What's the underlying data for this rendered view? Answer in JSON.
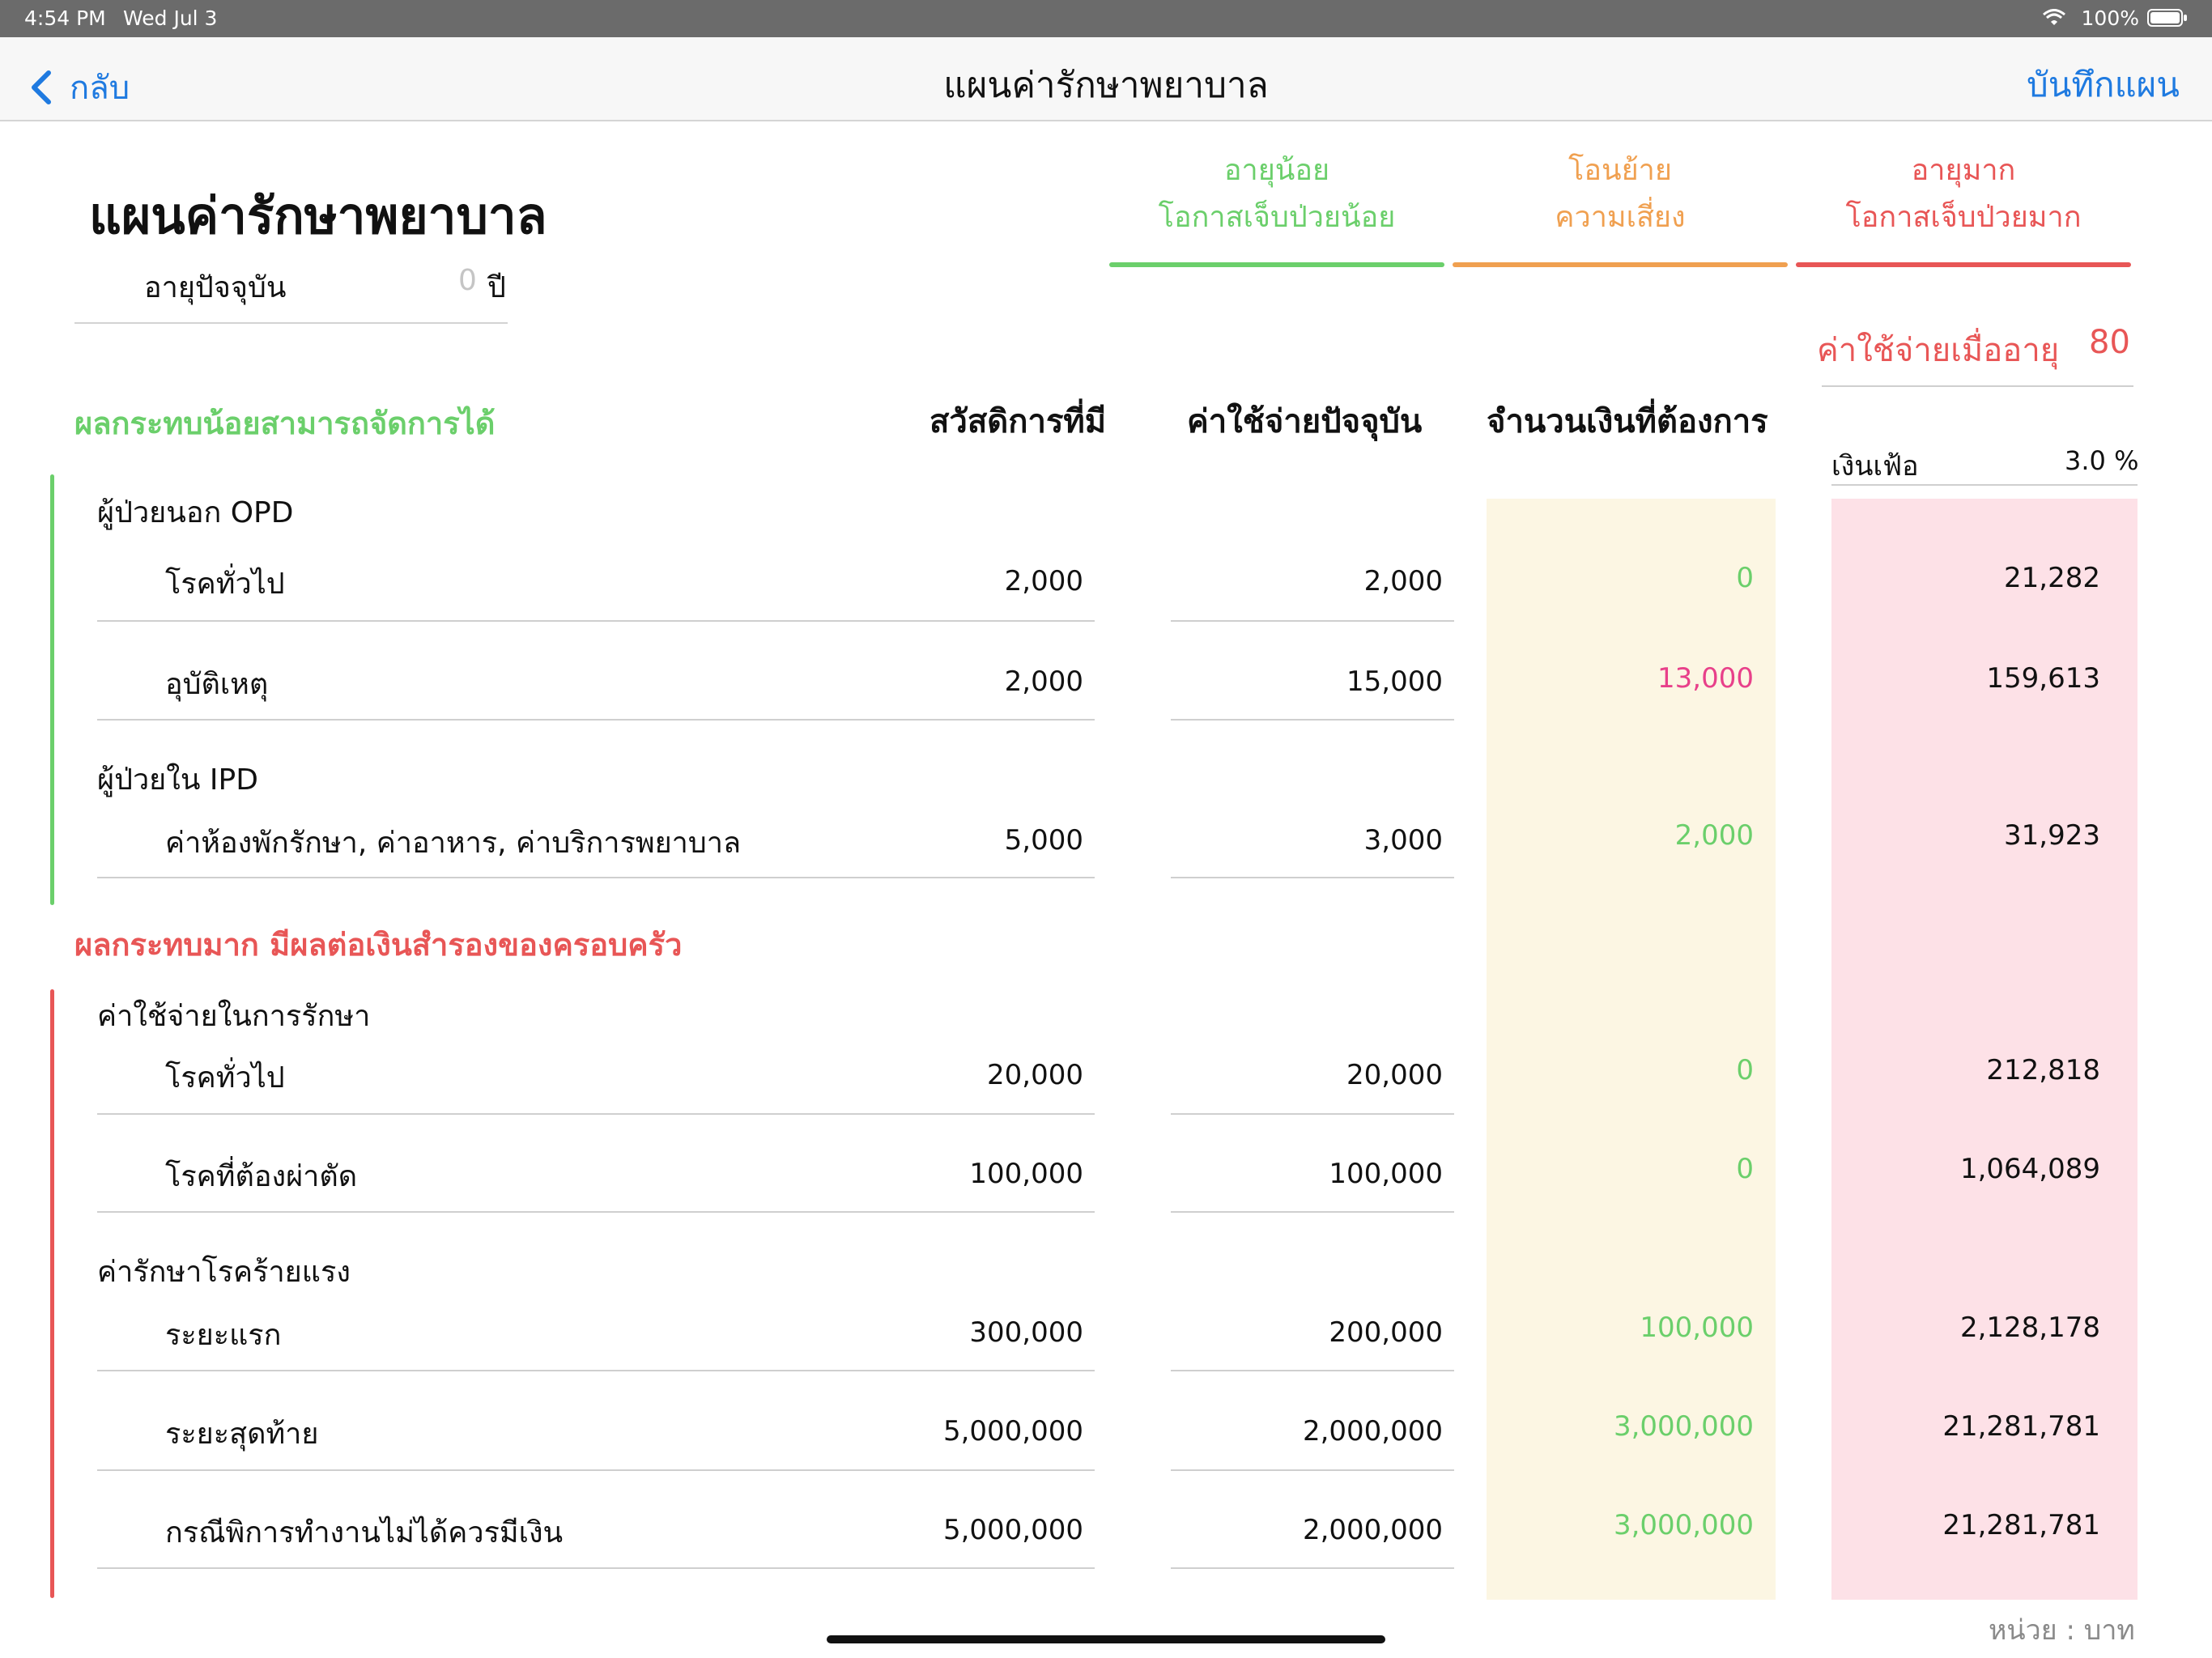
{
  "status_bar": {
    "time": "4:54 PM",
    "date": "Wed Jul 3",
    "battery": "100%"
  },
  "nav": {
    "back_label": "กลับ",
    "title": "แผนค่ารักษาพยาบาล",
    "save_label": "บันทึกแผน"
  },
  "page_title": "แผนค่ารักษาพยาบาล",
  "age": {
    "label": "อายุปัจจุบัน",
    "value": "0",
    "unit": "ปี"
  },
  "tabs": [
    {
      "line1": "อายุน้อย",
      "line2": "โอกาสเจ็บป่วยน้อย",
      "color": "#6bcf6b"
    },
    {
      "line1": "โอนย้าย",
      "line2": "ความเสี่ยง",
      "color": "#f0a050"
    },
    {
      "line1": "อายุมาก",
      "line2": "โอกาสเจ็บป่วยมาก",
      "color": "#e85656"
    }
  ],
  "future_age": {
    "label": "ค่าใช้จ่ายเมื่ออายุ",
    "value": "80"
  },
  "inflation": {
    "label": "เงินเฟ้อ",
    "value": "3.0 %"
  },
  "columns": {
    "benefits": "สวัสดิการที่มี",
    "current_cost": "ค่าใช้จ่ายปัจจุบัน",
    "needed": "จำนวนเงินที่ต้องการ"
  },
  "section_low": {
    "title": "ผลกระทบน้อยสามารถจัดการได้",
    "groups": [
      {
        "name": "ผู้ป่วยนอก OPD",
        "rows": [
          {
            "name": "โรคทั่วไป",
            "benefit": "2,000",
            "current": "2,000",
            "needed": "0",
            "needed_color": "#6bcf6b",
            "future": "21,282"
          },
          {
            "name": "อุบัติเหตุ",
            "benefit": "2,000",
            "current": "15,000",
            "needed": "13,000",
            "needed_color": "#e8408a",
            "future": "159,613"
          }
        ]
      },
      {
        "name": "ผู้ป่วยใน IPD",
        "rows": [
          {
            "name": "ค่าห้องพักรักษา, ค่าอาหาร, ค่าบริการพยาบาล",
            "benefit": "5,000",
            "current": "3,000",
            "needed": "2,000",
            "needed_color": "#6bcf6b",
            "future": "31,923"
          }
        ]
      }
    ]
  },
  "section_high": {
    "title": "ผลกระทบมาก มีผลต่อเงินสำรองของครอบครัว",
    "groups": [
      {
        "name": "ค่าใช้จ่ายในการรักษา",
        "rows": [
          {
            "name": "โรคทั่วไป",
            "benefit": "20,000",
            "current": "20,000",
            "needed": "0",
            "needed_color": "#6bcf6b",
            "future": "212,818"
          },
          {
            "name": "โรคที่ต้องผ่าตัด",
            "benefit": "100,000",
            "current": "100,000",
            "needed": "0",
            "needed_color": "#6bcf6b",
            "future": "1,064,089"
          }
        ]
      },
      {
        "name": "ค่ารักษาโรคร้ายแรง",
        "rows": [
          {
            "name": "ระยะแรก",
            "benefit": "300,000",
            "current": "200,000",
            "needed": "100,000",
            "needed_color": "#6bcf6b",
            "future": "2,128,178"
          },
          {
            "name": "ระยะสุดท้าย",
            "benefit": "5,000,000",
            "current": "2,000,000",
            "needed": "3,000,000",
            "needed_color": "#6bcf6b",
            "future": "21,281,781"
          },
          {
            "name": "กรณีพิการทำงานไม่ได้ควรมีเงิน",
            "benefit": "5,000,000",
            "current": "2,000,000",
            "needed": "3,000,000",
            "needed_color": "#6bcf6b",
            "future": "21,281,781"
          }
        ]
      }
    ]
  },
  "unit_note": "หน่วย : บาท"
}
